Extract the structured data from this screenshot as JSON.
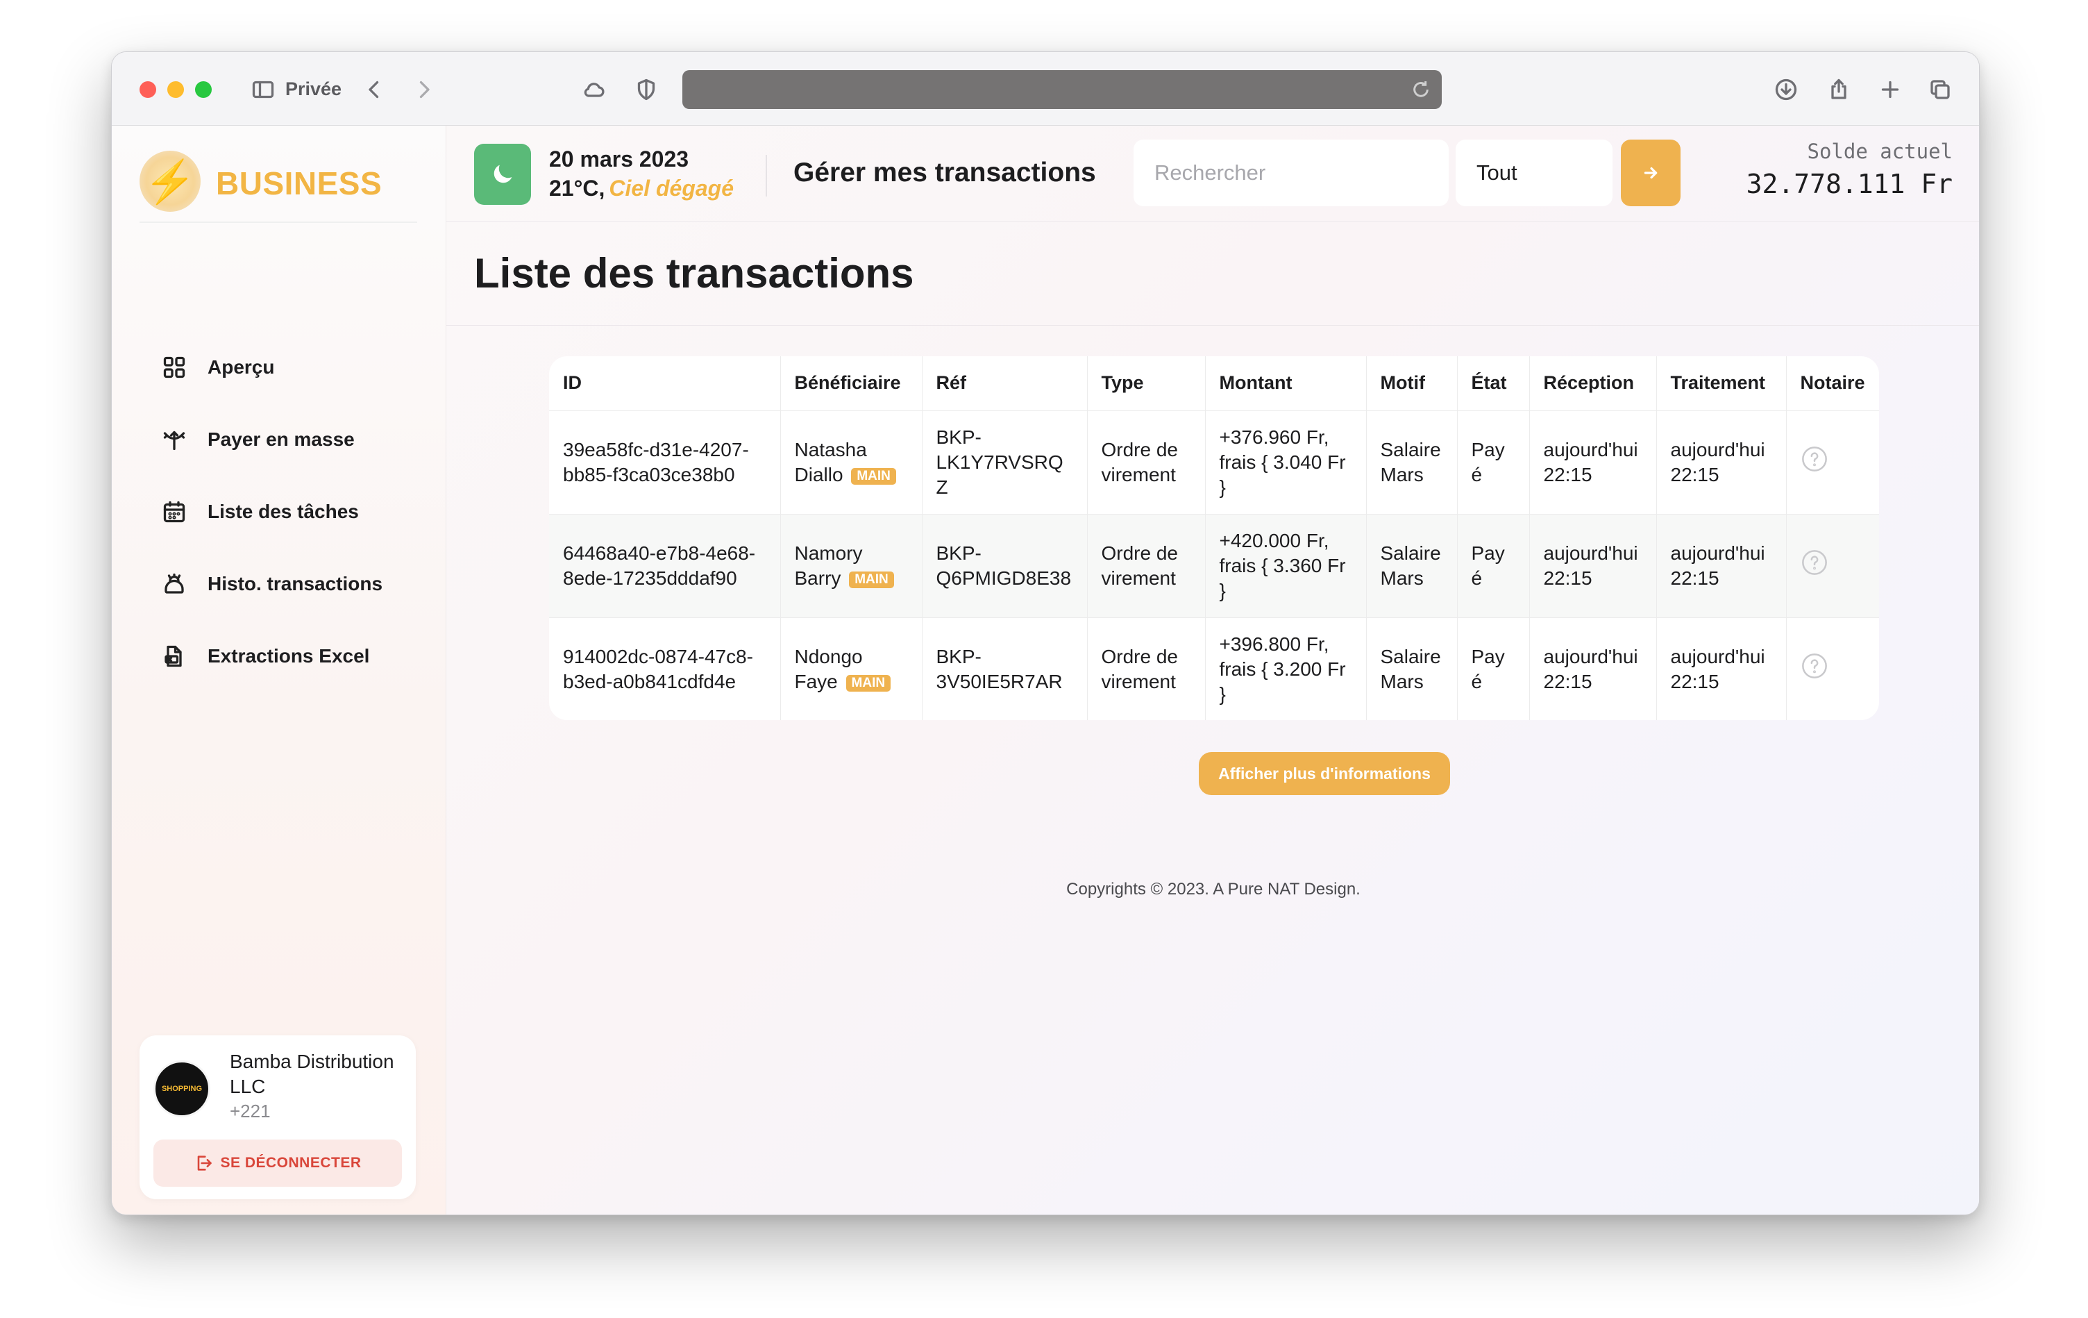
{
  "browser": {
    "private_label": "Privée"
  },
  "brand": {
    "name": "BUSINESS"
  },
  "nav": {
    "items": [
      {
        "label": "Aperçu",
        "icon": "grid-icon"
      },
      {
        "label": "Payer en masse",
        "icon": "bulk-transfer-icon"
      },
      {
        "label": "Liste des tâches",
        "icon": "calendar-icon"
      },
      {
        "label": "Histo. transactions",
        "icon": "history-icon"
      },
      {
        "label": "Extractions Excel",
        "icon": "excel-file-icon"
      }
    ]
  },
  "user": {
    "name": "Bamba Distribution LLC",
    "phone": "+221",
    "avatar_text": "SHOPPING",
    "logout_label": "SE DÉCONNECTER"
  },
  "header": {
    "date": "20 mars 2023",
    "temperature": "21°C,",
    "sky": "Ciel dégagé",
    "title": "Gérer mes transactions",
    "search_placeholder": "Rechercher",
    "filter_value": "Tout",
    "balance_label": "Solde actuel",
    "balance_value": "32.778.111 Fr"
  },
  "page": {
    "title": "Liste des transactions"
  },
  "table": {
    "columns": [
      "ID",
      "Bénéficiaire",
      "Réf",
      "Type",
      "Montant",
      "Motif",
      "État",
      "Réception",
      "Traitement",
      "Notaire"
    ],
    "rows": [
      {
        "id": "39ea58fc-d31e-4207-bb85-f3ca03ce38b0",
        "beneficiary": "Natasha Diallo",
        "tag": "MAIN",
        "ref": "BKP-LK1Y7RVSRQZ",
        "type": "Ordre de virement",
        "amount": "+376.960 Fr, frais { 3.040 Fr }",
        "motive": "Salaire Mars",
        "state": "Payé",
        "reception": "aujourd'hui 22:15",
        "processing": "aujourd'hui 22:15"
      },
      {
        "id": "64468a40-e7b8-4e68-8ede-17235dddaf90",
        "beneficiary": "Namory Barry",
        "tag": "MAIN",
        "ref": "BKP-Q6PMIGD8E38",
        "type": "Ordre de virement",
        "amount": "+420.000 Fr, frais { 3.360 Fr }",
        "motive": "Salaire Mars",
        "state": "Payé",
        "reception": "aujourd'hui 22:15",
        "processing": "aujourd'hui 22:15"
      },
      {
        "id": "914002dc-0874-47c8-b3ed-a0b841cdfd4e",
        "beneficiary": "Ndongo Faye",
        "tag": "MAIN",
        "ref": "BKP-3V50IE5R7AR",
        "type": "Ordre de virement",
        "amount": "+396.800 Fr, frais { 3.200 Fr }",
        "motive": "Salaire Mars",
        "state": "Payé",
        "reception": "aujourd'hui 22:15",
        "processing": "aujourd'hui 22:15"
      }
    ]
  },
  "more_button": "Afficher plus d'informations",
  "footer": "Copyrights © 2023. A Pure NAT Design.",
  "colors": {
    "accent": "#efb24f",
    "weather": "#5aba78",
    "logout_text": "#d9463a"
  }
}
